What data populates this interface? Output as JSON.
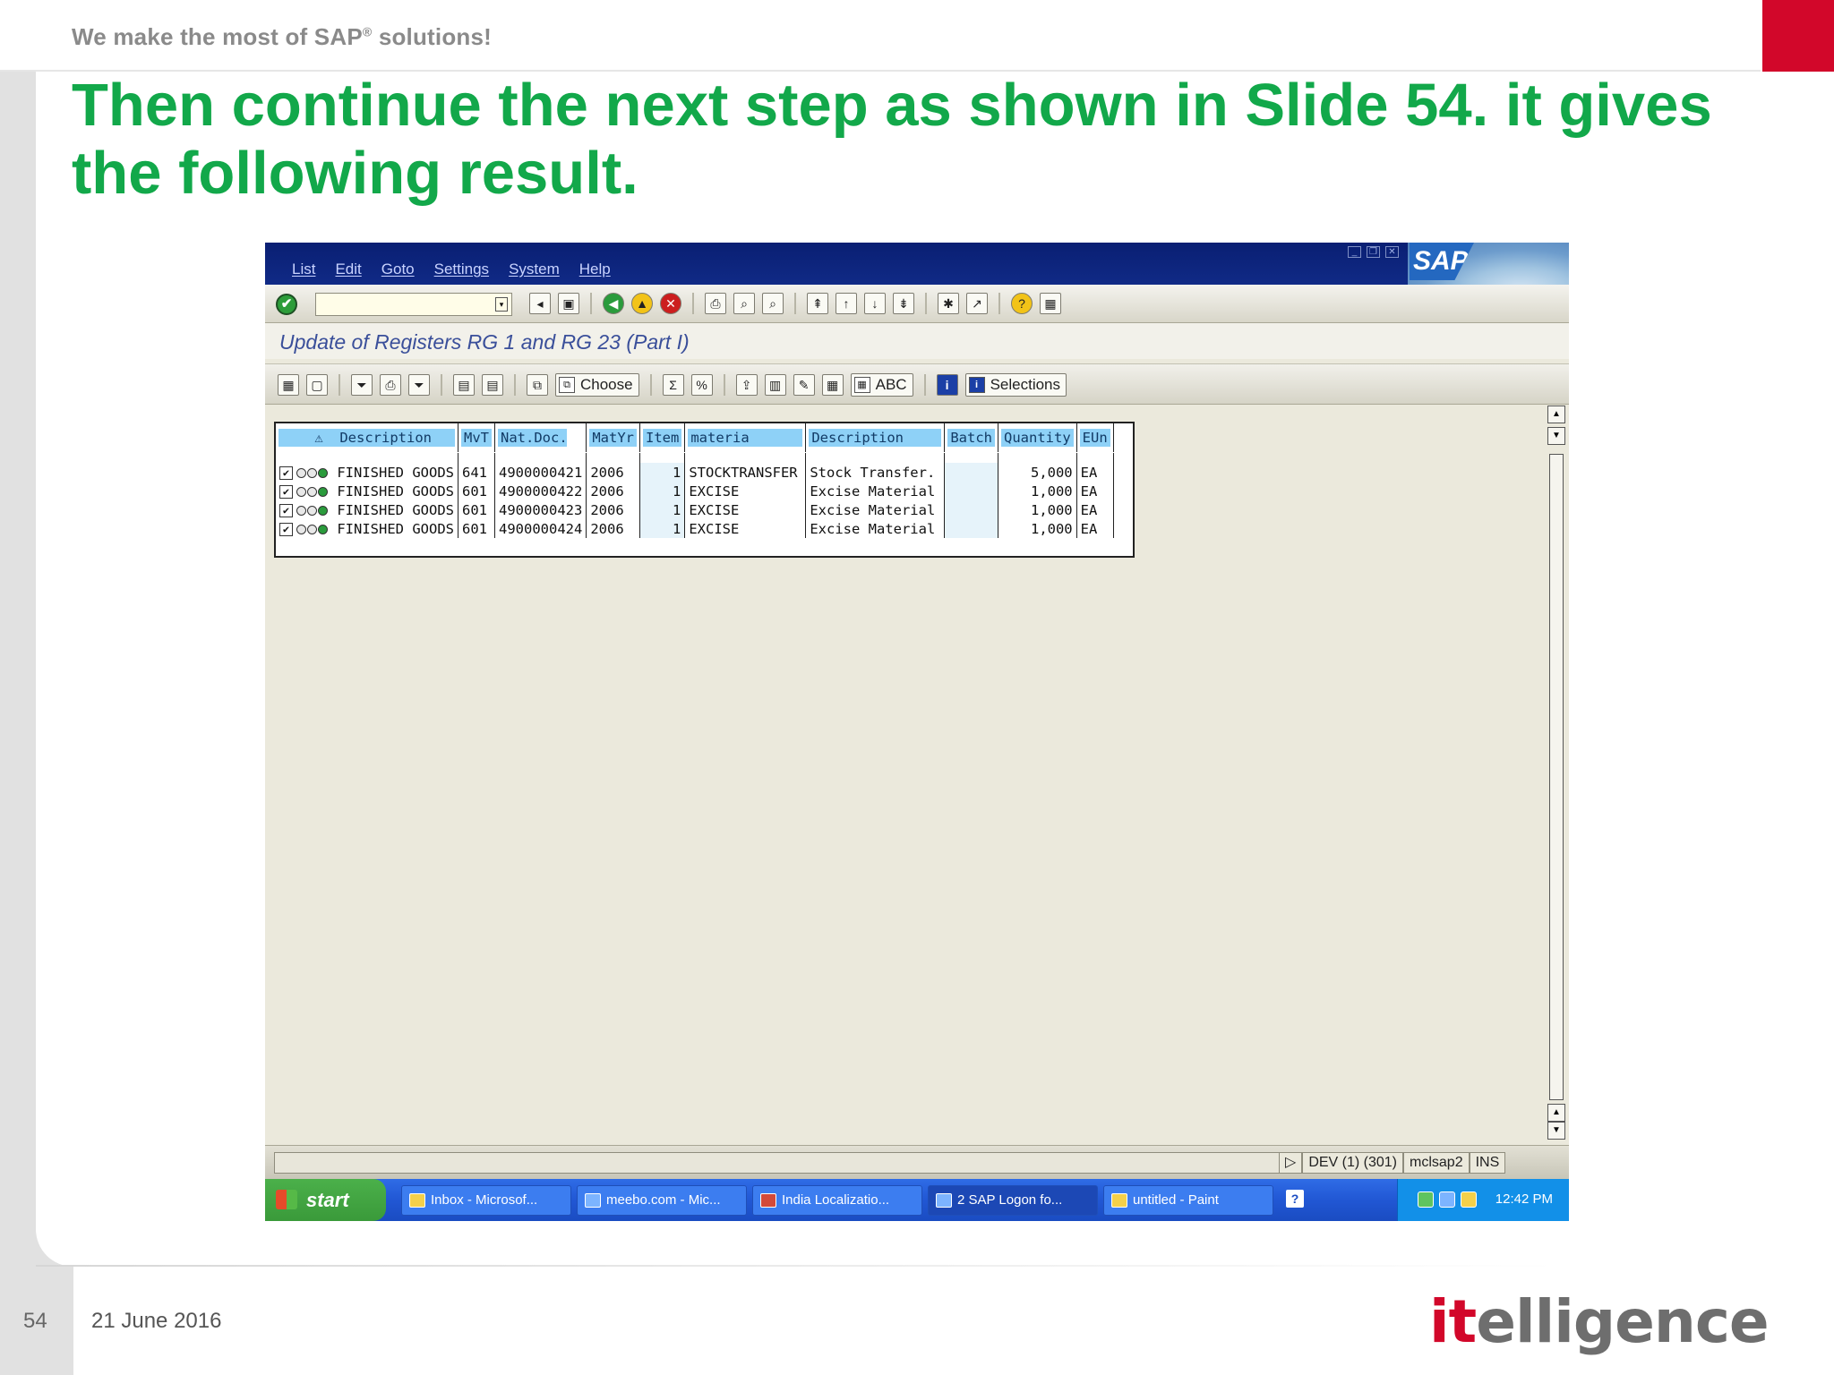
{
  "slide": {
    "tagline": "We make the most of SAP",
    "tagline_reg": "®",
    "tagline_tail": " solutions!",
    "title": "Then continue the next step as shown in Slide 54. it gives the following result.",
    "page_number": "54",
    "date": "21 June 2016",
    "logo_red": "it",
    "logo_gray": "elligence",
    "accent_color": "#12a84a",
    "brand_red": "#d2072a"
  },
  "sap": {
    "menu": [
      "List",
      "Edit",
      "Goto",
      "Settings",
      "System",
      "Help"
    ],
    "logo_text": "SAP",
    "ok_icon": "✔",
    "command_field": {
      "value": "",
      "placeholder": ""
    },
    "screen_title": "Update of Registers RG 1 and RG 23 (Part I)",
    "toolbar2": {
      "choose_label": "Choose",
      "abc_label": "ABC",
      "selections_label": "Selections"
    },
    "table": {
      "headers": [
        "Description",
        "MvT",
        "Nat.Doc.",
        "MatYr",
        "Item",
        "materia",
        "Description",
        "Batch",
        "Quantity",
        "EUn"
      ],
      "rows": [
        {
          "check": "✔",
          "desc": "FINISHED GOODS",
          "mvt": "641",
          "doc": "4900000421",
          "year": "2006",
          "item": "1",
          "materia": "STOCKTRANSFER",
          "desc2": "Stock Transfer.",
          "batch": "",
          "qty": "5,000",
          "eun": "EA"
        },
        {
          "check": "✔",
          "desc": "FINISHED GOODS",
          "mvt": "601",
          "doc": "4900000422",
          "year": "2006",
          "item": "1",
          "materia": "EXCISE",
          "desc2": "Excise Material",
          "batch": "",
          "qty": "1,000",
          "eun": "EA"
        },
        {
          "check": "✔",
          "desc": "FINISHED GOODS",
          "mvt": "601",
          "doc": "4900000423",
          "year": "2006",
          "item": "1",
          "materia": "EXCISE",
          "desc2": "Excise Material",
          "batch": "",
          "qty": "1,000",
          "eun": "EA"
        },
        {
          "check": "✔",
          "desc": "FINISHED GOODS",
          "mvt": "601",
          "doc": "4900000424",
          "year": "2006",
          "item": "1",
          "materia": "EXCISE",
          "desc2": "Excise Material",
          "batch": "",
          "qty": "1,000",
          "eun": "EA"
        }
      ]
    },
    "status": {
      "system": "DEV (1) (301)",
      "server": "mclsap2",
      "mode": "INS"
    }
  },
  "taskbar": {
    "start_label": "start",
    "items": [
      "Inbox - Microsof...",
      "meebo.com - Mic...",
      "India Localizatio...",
      "2 SAP Logon fo...",
      "untitled - Paint"
    ],
    "help_label": "?",
    "time": "12:42 PM"
  }
}
